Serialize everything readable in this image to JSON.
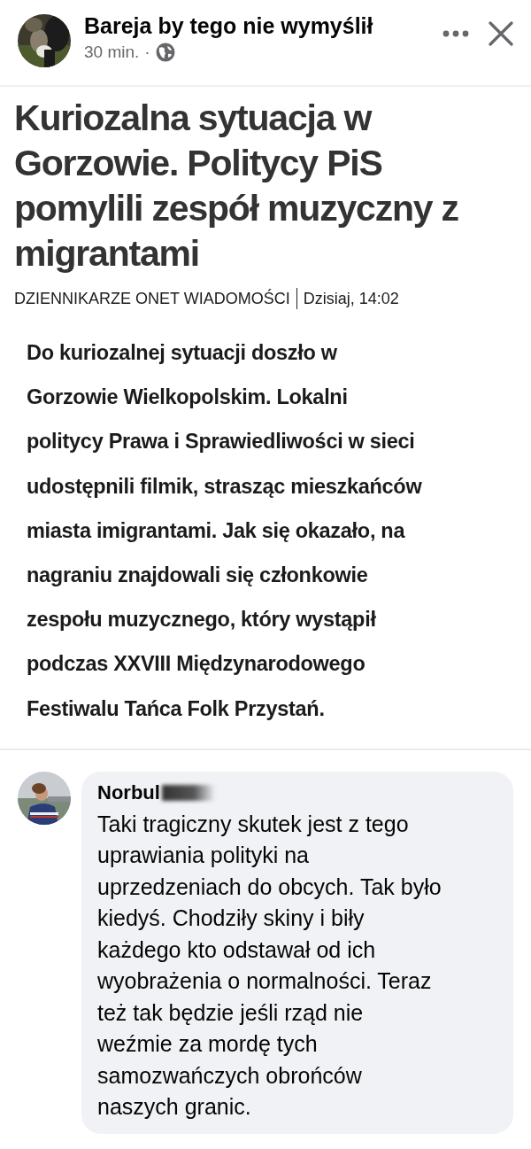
{
  "post": {
    "author": "Bareja by tego nie wymyślił",
    "time": "30 min.",
    "separator": "·"
  },
  "article": {
    "headline": "Kuriozalna sytuacja w\nGorzowie. Politycy PiS\npomylili zespół muzyczny z\nmigrantami",
    "source": "DZIENNIKARZE ONET WIADOMOŚCI",
    "date": "Dzisiaj, 14:02",
    "lead": "Do kuriozalnej sytuacji doszło w\nGorzowie Wielkopolskim. Lokalni\npolitycy Prawa i Sprawiedliwości w sieci\nudostępnili filmik, strasząc mieszkańców\nmiasta imigrantami. Jak się okazało, na\nnagraniu znajdowali się członkowie\nzespołu muzycznego, który wystąpił\npodczas XXVIII Międzynarodowego\nFestiwalu Tańca Folk Przystań."
  },
  "comment": {
    "author": "Norbul",
    "text": "Taki tragiczny skutek jest z tego\nuprawiania polityki na\nuprzedzeniach do obcych. Tak było\nkiedyś. Chodziły skiny i biły\nkażdego kto odstawał od ich\nwyobrażenia o normalności. Teraz\nteż tak będzie jeśli rząd nie\nweźmie za mordę tych\nsamozwańczych obrońców\nnaszych granic."
  }
}
